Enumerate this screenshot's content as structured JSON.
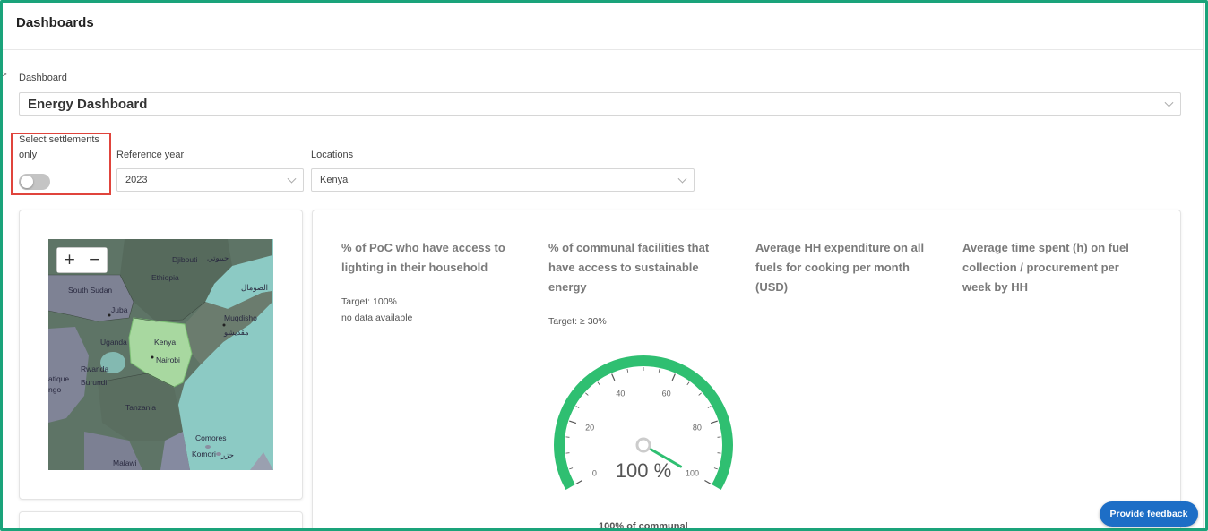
{
  "header": {
    "title": "Dashboards"
  },
  "filters": {
    "dashboard_label": "Dashboard",
    "dashboard_value": "Energy Dashboard",
    "settlements_label_line1": "Select settlements",
    "settlements_label_line2": "only",
    "settlements_toggle_on": false,
    "year_label": "Reference year",
    "year_value": "2023",
    "locations_label": "Locations",
    "locations_value": "Kenya"
  },
  "map": {
    "zoom_in": "+",
    "zoom_out": "−",
    "labels": {
      "djibouti": "Djibouti",
      "djibouti_ar": "جيبوتي",
      "ethiopia": "Ethiopia",
      "south_sudan": "South Sudan",
      "somalia_ar": "الصومال",
      "juba": "Juba",
      "muqdisho": "Muqdisho",
      "muqdisho_ar": "مقديشو",
      "kenya": "Kenya",
      "uganda": "Uganda",
      "nairobi": "Nairobi",
      "rwanda": "Rwanda",
      "burundi": "Burundi",
      "atique": "atique",
      "ngo": "ngo",
      "tanzania": "Tanzania",
      "comores": "Comores",
      "komori": "Komori",
      "komori_ar": "جزر",
      "malawi": "Malawi"
    }
  },
  "kpis": [
    {
      "title": "% of PoC who have access to lighting in their household",
      "target": "Target: 100%",
      "status": "no data available"
    },
    {
      "title": "% of communal facilities that have access to sustainable energy",
      "target": "Target: ≥ 30%"
    },
    {
      "title": "Average HH expenditure on all fuels for cooking per month (USD)"
    },
    {
      "title": "Average time spent (h) on fuel collection / procurement per week by HH"
    }
  ],
  "gauge": {
    "value": 100,
    "display": "100 %",
    "min": 0,
    "max": 100,
    "tick_labels": [
      "0",
      "20",
      "40",
      "60",
      "80",
      "100"
    ],
    "color": "#2fbf71"
  },
  "clipped_caption": "100% of communal",
  "feedback_label": "Provide feedback",
  "colors": {
    "accent": "#1d6ec6",
    "frame": "#1aa37a",
    "highlight": "#e0443c",
    "map_selected": "#a8d8a0"
  }
}
